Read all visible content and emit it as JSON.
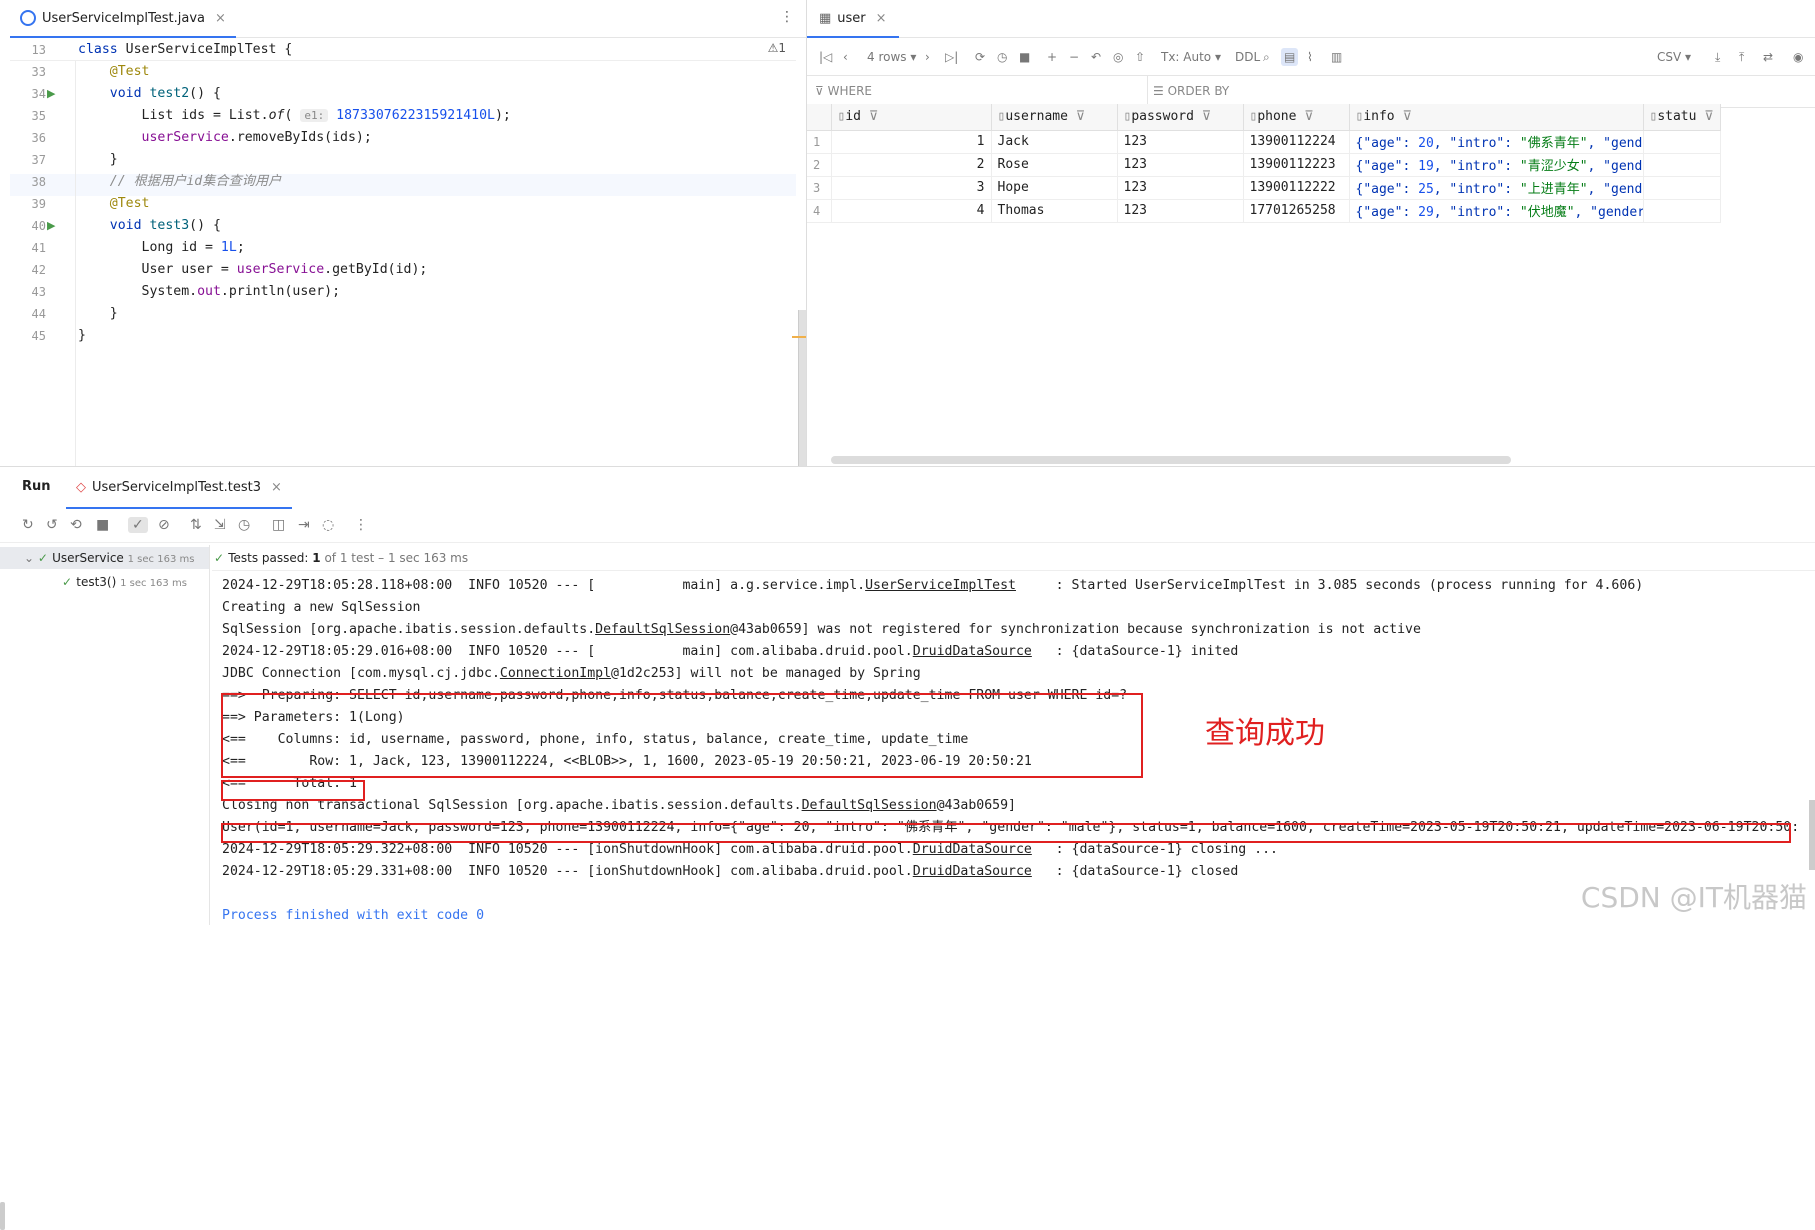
{
  "editor": {
    "tab_label": "UserServiceImplTest.java",
    "close": "×",
    "more": "⋮",
    "warning": "⚠1",
    "sticky": {
      "ln": "13",
      "text": "class UserServiceImplTest {"
    },
    "lines": [
      {
        "ln": "33",
        "parts": [
          {
            "c": "an",
            "t": "    @Test"
          }
        ]
      },
      {
        "ln": "34",
        "parts": [
          {
            "c": "",
            "t": "    "
          },
          {
            "c": "kw",
            "t": "void "
          },
          {
            "c": "fn",
            "t": "test2"
          },
          {
            "c": "",
            "t": "() {"
          }
        ]
      },
      {
        "ln": "35",
        "parts": [
          {
            "c": "",
            "t": "        List ids = List."
          },
          {
            "c": "it",
            "t": "of"
          },
          {
            "c": "",
            "t": "( "
          },
          {
            "c": "hint",
            "t": "e1:"
          },
          {
            "c": "num",
            "t": " 1873307622315921410L"
          },
          {
            "c": "",
            "t": ");"
          }
        ]
      },
      {
        "ln": "36",
        "parts": [
          {
            "c": "",
            "t": "        "
          },
          {
            "c": "fld",
            "t": "userService"
          },
          {
            "c": "",
            "t": ".removeByIds(ids);"
          }
        ]
      },
      {
        "ln": "37",
        "parts": [
          {
            "c": "",
            "t": "    }"
          }
        ]
      },
      {
        "ln": "38",
        "parts": [
          {
            "c": "cm",
            "t": "    // 根据用户id集合查询用户"
          }
        ]
      },
      {
        "ln": "39",
        "parts": [
          {
            "c": "an",
            "t": "    @Test"
          }
        ]
      },
      {
        "ln": "40",
        "parts": [
          {
            "c": "",
            "t": "    "
          },
          {
            "c": "kw",
            "t": "void "
          },
          {
            "c": "fn",
            "t": "test3"
          },
          {
            "c": "",
            "t": "() {"
          }
        ]
      },
      {
        "ln": "41",
        "parts": [
          {
            "c": "",
            "t": "        Long id = "
          },
          {
            "c": "num",
            "t": "1L"
          },
          {
            "c": "",
            "t": ";"
          }
        ]
      },
      {
        "ln": "42",
        "parts": [
          {
            "c": "",
            "t": "        User user = "
          },
          {
            "c": "fld",
            "t": "userService"
          },
          {
            "c": "",
            "t": ".getById(id);"
          }
        ]
      },
      {
        "ln": "43",
        "parts": [
          {
            "c": "",
            "t": "        System."
          },
          {
            "c": "fld",
            "t": "out"
          },
          {
            "c": "",
            "t": ".println(user);"
          }
        ]
      },
      {
        "ln": "44",
        "parts": [
          {
            "c": "",
            "t": "    }"
          }
        ]
      },
      {
        "ln": "45",
        "parts": [
          {
            "c": "",
            "t": "}"
          }
        ]
      }
    ]
  },
  "db": {
    "tab_label": "user",
    "close": "×",
    "rows_label": "4 rows",
    "tx_label": "Tx: Auto",
    "ddl_label": "DDL",
    "csv_label": "CSV",
    "where_label": "WHERE",
    "orderby_label": "ORDER BY",
    "columns": [
      "id",
      "username",
      "password",
      "phone",
      "info",
      "statu"
    ],
    "rows": [
      {
        "n": "1",
        "id": "1",
        "username": "Jack",
        "password": "123",
        "phone": "13900112224",
        "info": [
          {
            "c": "js",
            "t": "{\"age\": "
          },
          {
            "c": "jsn",
            "t": "20"
          },
          {
            "c": "js",
            "t": ", \"intro\": "
          },
          {
            "c": "jss",
            "t": "\"佛系青年\""
          },
          {
            "c": "js",
            "t": ", \"gender\":"
          }
        ]
      },
      {
        "n": "2",
        "id": "2",
        "username": "Rose",
        "password": "123",
        "phone": "13900112223",
        "info": [
          {
            "c": "js",
            "t": "{\"age\": "
          },
          {
            "c": "jsn",
            "t": "19"
          },
          {
            "c": "js",
            "t": ", \"intro\": "
          },
          {
            "c": "jss",
            "t": "\"青涩少女\""
          },
          {
            "c": "js",
            "t": ", \"gender\":"
          }
        ]
      },
      {
        "n": "3",
        "id": "3",
        "username": "Hope",
        "password": "123",
        "phone": "13900112222",
        "info": [
          {
            "c": "js",
            "t": "{\"age\": "
          },
          {
            "c": "jsn",
            "t": "25"
          },
          {
            "c": "js",
            "t": ", \"intro\": "
          },
          {
            "c": "jss",
            "t": "\"上进青年\""
          },
          {
            "c": "js",
            "t": ", \"gender\":"
          }
        ]
      },
      {
        "n": "4",
        "id": "4",
        "username": "Thomas",
        "password": "123",
        "phone": "17701265258",
        "info": [
          {
            "c": "js",
            "t": "{\"age\": "
          },
          {
            "c": "jsn",
            "t": "29"
          },
          {
            "c": "js",
            "t": ", \"intro\": "
          },
          {
            "c": "jss",
            "t": "\"伏地魔\""
          },
          {
            "c": "js",
            "t": ", \"gender\": \"m"
          }
        ]
      }
    ]
  },
  "run": {
    "label": "Run",
    "tab_label": "UserServiceImplTest.test3",
    "close": "×",
    "tree": [
      {
        "label": "UserService",
        "dur": "1 sec 163 ms"
      },
      {
        "label": "test3()",
        "dur": "1 sec 163 ms"
      }
    ],
    "passed_label": "Tests passed:",
    "passed_count": "1",
    "passed_rest": " of 1 test – 1 sec 163 ms",
    "log": [
      [
        {
          "t": "2024-12-29T18:05:28.118+08:00  INFO 10520 --- [           main] a.g.service.impl."
        },
        {
          "u": 1,
          "t": "UserServiceImplTest"
        },
        {
          "t": "     : Started UserServiceImplTest in 3.085 seconds (process running for 4.606)"
        }
      ],
      [
        {
          "t": "Creating a new SqlSession"
        }
      ],
      [
        {
          "t": "SqlSession [org.apache.ibatis.session.defaults."
        },
        {
          "u": 1,
          "t": "DefaultSqlSession"
        },
        {
          "t": "@43ab0659] was not registered for synchronization because synchronization is not active"
        }
      ],
      [
        {
          "t": "2024-12-29T18:05:29.016+08:00  INFO 10520 --- [           main] com.alibaba.druid.pool."
        },
        {
          "u": 1,
          "t": "DruidDataSource"
        },
        {
          "t": "   : {dataSource-1} inited"
        }
      ],
      [
        {
          "t": "JDBC Connection [com.mysql.cj.jdbc."
        },
        {
          "u": 1,
          "t": "ConnectionImpl"
        },
        {
          "t": "@1d2c253] will not be managed by Spring"
        }
      ],
      [
        {
          "t": "==>  Preparing: SELECT id,username,password,phone,info,status,balance,create_time,update_time FROM user WHERE id=?"
        }
      ],
      [
        {
          "t": "==> Parameters: 1(Long)"
        }
      ],
      [
        {
          "t": "<==    Columns: id, username, password, phone, info, status, balance, create_time, update_time"
        }
      ],
      [
        {
          "t": "<==        Row: 1, Jack, 123, 13900112224, <<BLOB>>, 1, 1600, 2023-05-19 20:50:21, 2023-06-19 20:50:21"
        }
      ],
      [
        {
          "t": "<==      Total: 1"
        }
      ],
      [
        {
          "t": "Closing non transactional SqlSession [org.apache.ibatis.session.defaults."
        },
        {
          "u": 1,
          "t": "DefaultSqlSession"
        },
        {
          "t": "@43ab0659]"
        }
      ],
      [
        {
          "t": "User(id=1, username=Jack, password=123, phone=13900112224, info={\"age\": 20, \"intro\": \"佛系青年\", \"gender\": \"male\"}, status=1, balance=1600, createTime=2023-05-19T20:50:21, updateTime=2023-06-19T20:50:"
        }
      ],
      [
        {
          "t": "2024-12-29T18:05:29.322+08:00  INFO 10520 --- [ionShutdownHook] com.alibaba.druid.pool."
        },
        {
          "u": 1,
          "t": "DruidDataSource"
        },
        {
          "t": "   : {dataSource-1} closing ..."
        }
      ],
      [
        {
          "t": "2024-12-29T18:05:29.331+08:00  INFO 10520 --- [ionShutdownHook] com.alibaba.druid.pool."
        },
        {
          "u": 1,
          "t": "DruidDataSource"
        },
        {
          "t": "   : {dataSource-1} closed"
        }
      ],
      [
        {
          "t": ""
        }
      ],
      [
        {
          "t": "Process finished with exit code 0",
          "c": "#3574f0"
        }
      ]
    ],
    "annotation": "查询成功"
  },
  "watermark": "CSDN @IT机器猫",
  "colors": {
    "accent": "#3574f0",
    "highlight_box": "#e02020",
    "pass_green": "#4a9a4a"
  }
}
